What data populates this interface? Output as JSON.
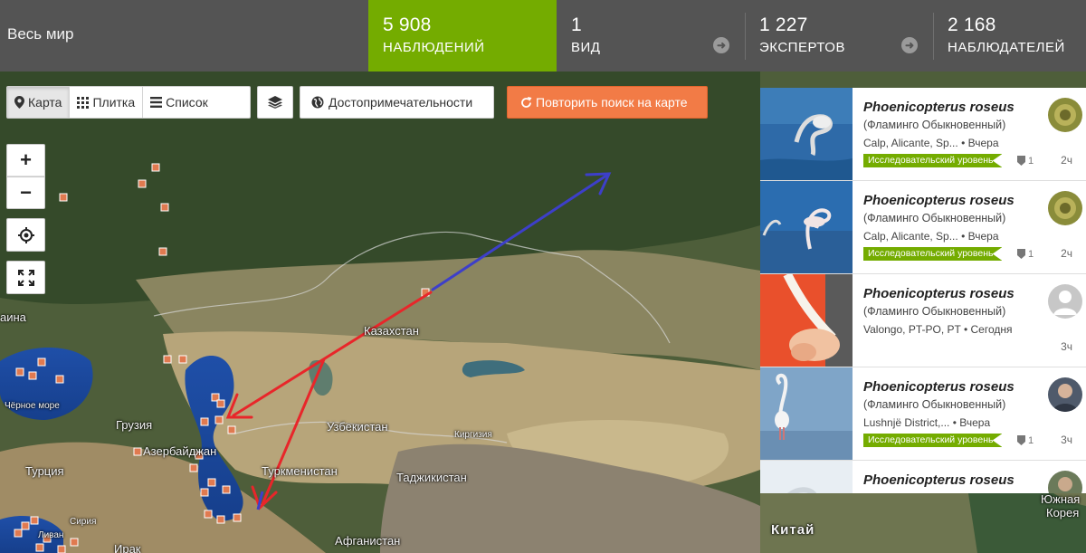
{
  "header": {
    "place": "Весь мир",
    "stats": [
      {
        "number": "5 908",
        "label": "НАБЛЮДЕНИЙ"
      },
      {
        "number": "1",
        "label": "ВИД"
      },
      {
        "number": "1 227",
        "label": "ЭКСПЕРТОВ"
      },
      {
        "number": "2 168",
        "label": "НАБЛЮДАТЕЛЕЙ"
      }
    ],
    "arrow_glyph": "➜"
  },
  "toolbar": {
    "views": [
      {
        "label": "Карта",
        "icon": "map-marker-icon",
        "active": true
      },
      {
        "label": "Плитка",
        "icon": "grid-icon",
        "active": false
      },
      {
        "label": "Список",
        "icon": "list-icon",
        "active": false
      }
    ],
    "layers_icon": "layers-icon",
    "places_label": "Достопримечательности",
    "redo_label": "Повторить поиск на карте"
  },
  "map_controls": {
    "zoom_in": "+",
    "zoom_out": "−"
  },
  "map_labels": [
    {
      "text": "Казахстан",
      "size": "normal"
    },
    {
      "text": "Узбекистан",
      "size": "normal"
    },
    {
      "text": "Туркменистан",
      "size": "normal"
    },
    {
      "text": "Таджикистан",
      "size": "normal"
    },
    {
      "text": "Киргизия",
      "size": "small"
    },
    {
      "text": "Афганистан",
      "size": "normal"
    },
    {
      "text": "Грузия",
      "size": "normal"
    },
    {
      "text": "Азербайджан",
      "size": "normal"
    },
    {
      "text": "Турция",
      "size": "normal"
    },
    {
      "text": "Сирия",
      "size": "small"
    },
    {
      "text": "Ливан",
      "size": "small"
    },
    {
      "text": "Ирак",
      "size": "normal"
    },
    {
      "text": "Чёрное море",
      "size": "small"
    },
    {
      "text": "аина",
      "size": "normal"
    },
    {
      "text": "Китай",
      "size": "big"
    },
    {
      "text": "Южная",
      "size": "normal"
    },
    {
      "text": "Корея",
      "size": "normal"
    }
  ],
  "observations": [
    {
      "scientific_name": "Phoenicopterus roseus",
      "common_name": "(Фламинго Обыкновенный)",
      "place": "Calp, Alicante, Sp...",
      "date": "• Вчера",
      "quality_grade": "Исследовательский уровень",
      "identifications": "1",
      "time_ago": "2ч"
    },
    {
      "scientific_name": "Phoenicopterus roseus",
      "common_name": "(Фламинго Обыкновенный)",
      "place": "Calp, Alicante, Sp...",
      "date": "• Вчера",
      "quality_grade": "Исследовательский уровень",
      "identifications": "1",
      "time_ago": "2ч"
    },
    {
      "scientific_name": "Phoenicopterus roseus",
      "common_name": "(Фламинго Обыкновенный)",
      "place": "Valongo, PT-PO, PT",
      "date": "• Сегодня",
      "quality_grade": "",
      "identifications": "",
      "time_ago": "3ч"
    },
    {
      "scientific_name": "Phoenicopterus roseus",
      "common_name": "(Фламинго Обыкновенный)",
      "place": "Lushnjë District,...",
      "date": "• Вчера",
      "quality_grade": "Исследовательский уровень",
      "identifications": "1",
      "time_ago": "3ч"
    },
    {
      "scientific_name": "Phoenicopterus roseus",
      "common_name": "",
      "place": "",
      "date": "",
      "quality_grade": "",
      "identifications": "",
      "time_ago": ""
    }
  ],
  "colors": {
    "accent_green": "#74ac00",
    "header_bg": "#545454",
    "redo_orange": "#f27b46",
    "marker_fill": "#e07a50",
    "route_red": "#e8262a",
    "route_blue": "#3d3fc9"
  }
}
